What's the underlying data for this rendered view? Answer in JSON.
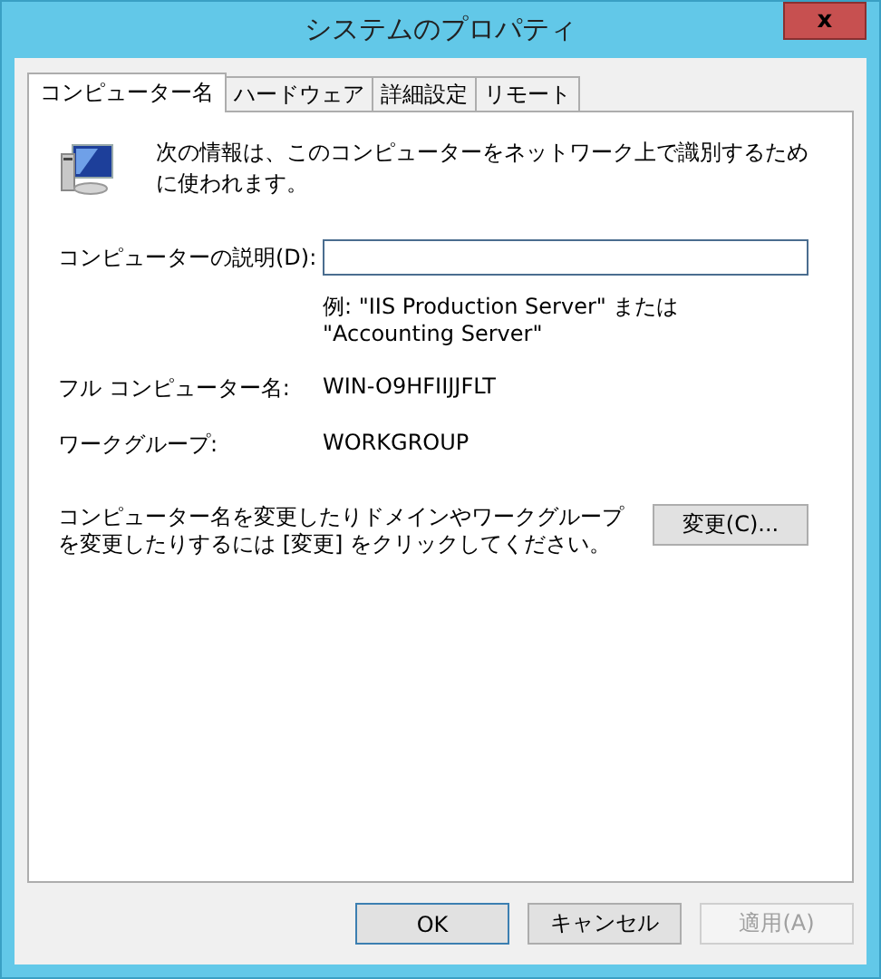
{
  "window": {
    "title": "システムのプロパティ",
    "close": "x"
  },
  "tabs": [
    {
      "label": "コンピューター名",
      "selected": true
    },
    {
      "label": "ハードウェア",
      "selected": false
    },
    {
      "label": "詳細設定",
      "selected": false
    },
    {
      "label": "リモート",
      "selected": false
    }
  ],
  "intro": "次の情報は、このコンピューターをネットワーク上で識別するために使われます。",
  "description": {
    "label": "コンピューターの説明(D):",
    "hint": "例: \"IIS Production Server\" または \"Accounting Server\""
  },
  "fields": [
    {
      "label": "フル コンピューター名:",
      "value": "WIN-O9HFIIJJFLT"
    },
    {
      "label": "ワークグループ:",
      "value": "WORKGROUP"
    }
  ],
  "change": {
    "text": "コンピューター名を変更したりドメインやワークグループを変更したりするには [変更] をクリックしてください。",
    "button": "変更(C)..."
  },
  "buttons": [
    {
      "label": "OK",
      "default": true,
      "disabled": false
    },
    {
      "label": "キャンセル",
      "default": false,
      "disabled": false
    },
    {
      "label": "適用(A)",
      "default": false,
      "disabled": true
    }
  ]
}
